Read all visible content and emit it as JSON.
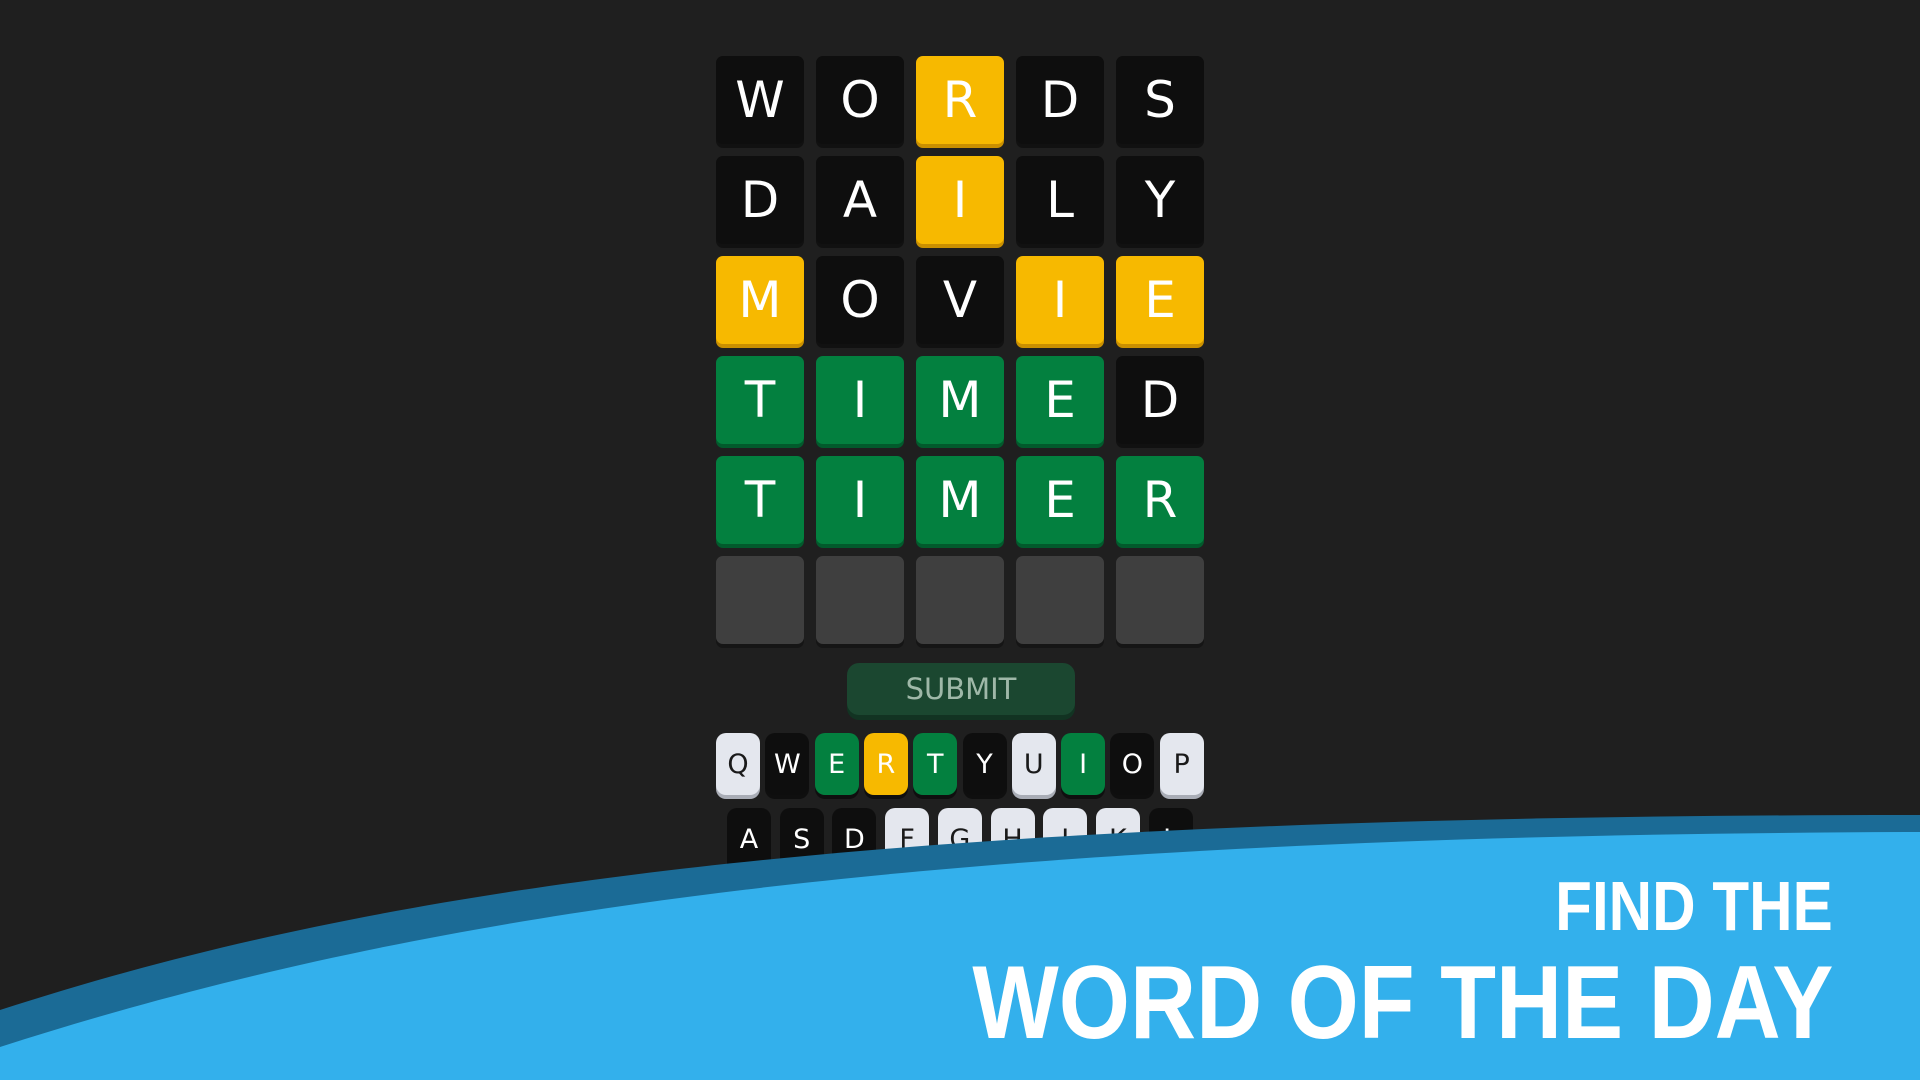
{
  "colors": {
    "background": "#1f1f1f",
    "absent": "#0e0e0e",
    "present": "#f7b900",
    "correct": "#03803f",
    "empty": "#3f3f3f",
    "unused_key": "#e4e7ee",
    "banner_blue": "#33b0ec",
    "banner_band": "#1b6b96"
  },
  "board": {
    "rows": [
      {
        "letters": [
          "W",
          "O",
          "R",
          "D",
          "S"
        ],
        "states": [
          "absent",
          "absent",
          "present",
          "absent",
          "absent"
        ]
      },
      {
        "letters": [
          "D",
          "A",
          "I",
          "L",
          "Y"
        ],
        "states": [
          "absent",
          "absent",
          "present",
          "absent",
          "absent"
        ]
      },
      {
        "letters": [
          "M",
          "O",
          "V",
          "I",
          "E"
        ],
        "states": [
          "present",
          "absent",
          "absent",
          "present",
          "present"
        ]
      },
      {
        "letters": [
          "T",
          "I",
          "M",
          "E",
          "D"
        ],
        "states": [
          "correct",
          "correct",
          "correct",
          "correct",
          "absent"
        ]
      },
      {
        "letters": [
          "T",
          "I",
          "M",
          "E",
          "R"
        ],
        "states": [
          "correct",
          "correct",
          "correct",
          "correct",
          "correct"
        ]
      },
      {
        "letters": [
          "",
          "",
          "",
          "",
          ""
        ],
        "states": [
          "empty",
          "empty",
          "empty",
          "empty",
          "empty"
        ]
      }
    ]
  },
  "submit_label": "SUBMIT",
  "keyboard": {
    "rows": [
      {
        "keys": [
          "Q",
          "W",
          "E",
          "R",
          "T",
          "Y",
          "U",
          "I",
          "O",
          "P"
        ],
        "states": [
          "unused",
          "absent",
          "correct",
          "present",
          "correct",
          "absent",
          "unused",
          "correct",
          "absent",
          "unused"
        ]
      },
      {
        "keys": [
          "A",
          "S",
          "D",
          "F",
          "G",
          "H",
          "J",
          "K",
          "L"
        ],
        "states": [
          "absent",
          "absent",
          "absent",
          "unused",
          "unused",
          "unused",
          "unused",
          "unused",
          "absent"
        ]
      }
    ]
  },
  "banner": {
    "line1": "FIND THE",
    "line2": "WORD OF THE DAY"
  }
}
